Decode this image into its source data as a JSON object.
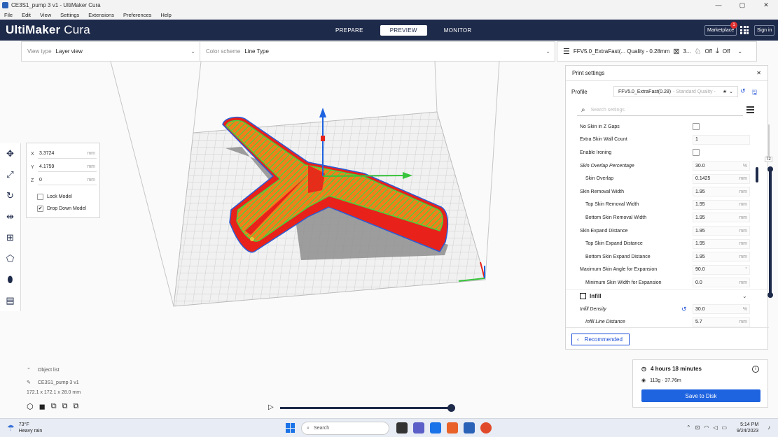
{
  "window": {
    "title": "CE3S1_pump 3 v1 - UltiMaker Cura",
    "controls": [
      "—",
      "▢",
      "✕"
    ]
  },
  "menu": [
    "File",
    "Edit",
    "View",
    "Settings",
    "Extensions",
    "Preferences",
    "Help"
  ],
  "header": {
    "brand_prefix": "UltiMaker",
    "brand_suffix": " Cura",
    "stages": [
      "PREPARE",
      "PREVIEW",
      "MONITOR"
    ],
    "active_stage": "PREVIEW",
    "marketplace": "Marketplace",
    "marketplace_badge": "1",
    "sign_in": "Sign in"
  },
  "topbar": {
    "view_type_label": "View type",
    "view_type_value": "Layer view",
    "color_scheme_label": "Color scheme",
    "color_scheme_value": "Line Type"
  },
  "printbar": {
    "profile": "FFV5.0_ExtraFast(... Quality - 0.28mm",
    "infill": "3...",
    "support": "Off",
    "adhesion": "Off"
  },
  "move_panel": {
    "x_label": "X",
    "x_value": "3.3724",
    "y_label": "Y",
    "y_value": "4.1759",
    "z_label": "Z",
    "z_value": "0",
    "unit": "mm",
    "lock_model": "Lock Model",
    "drop_down_model": "Drop Down Model",
    "drop_down_checked": "✔"
  },
  "settings_panel": {
    "title": "Print settings",
    "profile_label": "Profile",
    "profile_value": "FFV5.0_ExtraFast(0.28)",
    "profile_quality": "- Standard Quality -",
    "search_placeholder": "Search settings",
    "rows": [
      {
        "name": "No Skin in Z Gaps",
        "type": "check"
      },
      {
        "name": "Extra Skin Wall Count",
        "value": "1",
        "unit": ""
      },
      {
        "name": "Enable Ironing",
        "type": "check"
      },
      {
        "name": "Skin Overlap Percentage",
        "value": "30.0",
        "unit": "%",
        "italic": true
      },
      {
        "name": "Skin Overlap",
        "value": "0.1425",
        "unit": "mm",
        "indent": true
      },
      {
        "name": "Skin Removal Width",
        "value": "1.95",
        "unit": "mm"
      },
      {
        "name": "Top Skin Removal Width",
        "value": "1.95",
        "unit": "mm",
        "indent": true
      },
      {
        "name": "Bottom Skin Removal Width",
        "value": "1.95",
        "unit": "mm",
        "indent": true
      },
      {
        "name": "Skin Expand Distance",
        "value": "1.95",
        "unit": "mm"
      },
      {
        "name": "Top Skin Expand Distance",
        "value": "1.95",
        "unit": "mm",
        "indent": true
      },
      {
        "name": "Bottom Skin Expand Distance",
        "value": "1.95",
        "unit": "mm",
        "indent": true
      },
      {
        "name": "Maximum Skin Angle for Expansion",
        "value": "90.0",
        "unit": "°"
      },
      {
        "name": "Minimum Skin Width for Expansion",
        "value": "0.0",
        "unit": "mm",
        "indent": true
      }
    ],
    "category": "Infill",
    "infill_rows": [
      {
        "name": "Infill Density",
        "value": "30.0",
        "unit": "%",
        "italic": true,
        "reset": true
      },
      {
        "name": "Infill Line Distance",
        "value": "5.7",
        "unit": "mm",
        "italic": true,
        "indent": true
      }
    ],
    "recommended": "Recommended"
  },
  "layer_slider": {
    "value": "72"
  },
  "estimate": {
    "time": "4 hours 18 minutes",
    "material": "113g · 37.76m",
    "save": "Save to Disk"
  },
  "object_list": {
    "title": "Object list",
    "object_name": "CE3S1_pump 3 v1",
    "dimensions": "172.1 x 172.1 x 28.0 mm"
  },
  "taskbar": {
    "temp": "73°F",
    "weather": "Heavy rain",
    "search": "Search",
    "time": "5:14 PM",
    "date": "9/24/2023"
  },
  "colors": {
    "header": "#1e2a4a",
    "accent": "#1e63e0",
    "wall": "#e8221a",
    "infill": "#f07f1a",
    "skin": "#49d43c"
  }
}
